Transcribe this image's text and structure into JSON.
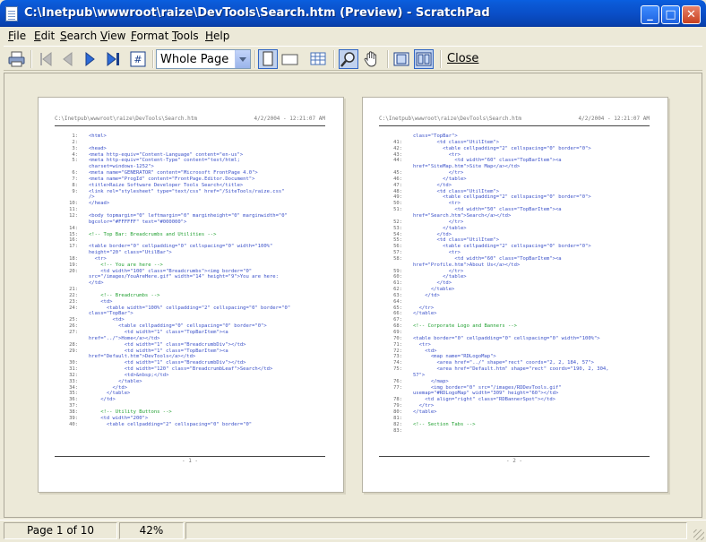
{
  "window": {
    "title": "C:\\Inetpub\\wwwroot\\raize\\DevTools\\Search.htm (Preview) - ScratchPad",
    "minimize": "_",
    "maximize": "□",
    "close": "✕"
  },
  "menu": [
    {
      "label": "File"
    },
    {
      "label": "Edit"
    },
    {
      "label": "Search"
    },
    {
      "label": "View"
    },
    {
      "label": "Format"
    },
    {
      "label": "Tools"
    },
    {
      "label": "Help"
    }
  ],
  "toolbar": {
    "zoom_value": "Whole Page",
    "close_label": "Close",
    "icons": [
      "printer-icon",
      "first-page-icon",
      "previous-page-icon",
      "next-page-icon",
      "last-page-icon",
      "goto-page-icon",
      "portrait-icon",
      "landscape-icon",
      "multi-page-icon",
      "zoom-icon",
      "hand-icon",
      "single-page-view-icon",
      "two-page-view-icon"
    ]
  },
  "pages": [
    {
      "header_path": "C:\\Inetpub\\wwwroot\\raize\\DevTools\\Search.htm",
      "header_date": "4/2/2004 - 12:21:07 AM",
      "footer": "- 1 -",
      "lines": [
        {
          "n": "1:",
          "t": "<html>",
          "k": "tag"
        },
        {
          "n": "2:",
          "t": "",
          "k": "tag"
        },
        {
          "n": "3:",
          "t": "<head>",
          "k": "tag"
        },
        {
          "n": "4:",
          "t": "<meta http-equiv=\"Content-Language\" content=\"en-us\">",
          "k": "tag"
        },
        {
          "n": "5:",
          "t": "<meta http-equiv=\"Content-Type\" content=\"text/html;",
          "k": "tag"
        },
        {
          "n": "",
          "t": "charset=windows-1252\">",
          "k": "tag"
        },
        {
          "n": "6:",
          "t": "<meta name=\"GENERATOR\" content=\"Microsoft FrontPage 4.0\">",
          "k": "tag"
        },
        {
          "n": "7:",
          "t": "<meta name=\"ProgId\" content=\"FrontPage.Editor.Document\">",
          "k": "tag"
        },
        {
          "n": "8:",
          "t": "<title>Raize Software Developer Tools Search</title>",
          "k": "tag"
        },
        {
          "n": "9:",
          "t": "<link rel=\"stylesheet\" type=\"text/css\" href=\"/SiteTools/raize.css\"",
          "k": "tag"
        },
        {
          "n": "",
          "t": "/>",
          "k": "tag"
        },
        {
          "n": "10:",
          "t": "</head>",
          "k": "tag"
        },
        {
          "n": "11:",
          "t": "",
          "k": "tag"
        },
        {
          "n": "12:",
          "t": "<body topmargin=\"0\" leftmargin=\"0\" marginheight=\"0\" marginwidth=\"0\"",
          "k": "tag"
        },
        {
          "n": "",
          "t": "bgcolor=\"#FFFFFF\" text=\"#000000\">",
          "k": "tag"
        },
        {
          "n": "14:",
          "t": "",
          "k": "tag"
        },
        {
          "n": "15:",
          "t": "<!-- Top Bar: Breadcrumbs and Utilities -->",
          "k": "cmt"
        },
        {
          "n": "16:",
          "t": "",
          "k": "tag"
        },
        {
          "n": "17:",
          "t": "<table border=\"0\" cellpadding=\"0\" cellspacing=\"0\" width=\"100%\"",
          "k": "tag"
        },
        {
          "n": "",
          "t": "height=\"20\" class=\"UtilBar\">",
          "k": "tag"
        },
        {
          "n": "18:",
          "t": "  <tr>",
          "k": "tag"
        },
        {
          "n": "19:",
          "t": "    <!-- You are here -->",
          "k": "cmt"
        },
        {
          "n": "20:",
          "t": "    <td width=\"100\" class=\"Breadcrumbs\"><img border=\"0\"",
          "k": "tag"
        },
        {
          "n": "",
          "t": "src=\"/images/YouAreHere.gif\" width=\"14\" height=\"9\">You are here:",
          "k": "tag"
        },
        {
          "n": "",
          "t": "</td>",
          "k": "tag"
        },
        {
          "n": "21:",
          "t": "",
          "k": "tag"
        },
        {
          "n": "22:",
          "t": "    <!-- Breadcrumbs -->",
          "k": "cmt"
        },
        {
          "n": "23:",
          "t": "    <td>",
          "k": "tag"
        },
        {
          "n": "24:",
          "t": "      <table width=\"100%\" cellpadding=\"2\" cellspacing=\"0\" border=\"0\"",
          "k": "tag"
        },
        {
          "n": "",
          "t": "class=\"TopBar\">",
          "k": "tag"
        },
        {
          "n": "25:",
          "t": "        <td>",
          "k": "tag"
        },
        {
          "n": "26:",
          "t": "          <table cellpadding=\"0\" cellspacing=\"0\" border=\"0\">",
          "k": "tag"
        },
        {
          "n": "27:",
          "t": "            <td width=\"1\" class=\"TopBarItem\"><a",
          "k": "tag"
        },
        {
          "n": "",
          "t": "href=\"../\">Home</a></td>",
          "k": "tag"
        },
        {
          "n": "28:",
          "t": "            <td width=\"1\" class=\"BreadcrumbDiv\"></td>",
          "k": "tag"
        },
        {
          "n": "29:",
          "t": "            <td width=\"1\" class=\"TopBarItem\"><a",
          "k": "tag"
        },
        {
          "n": "",
          "t": "href=\"Default.htm\">DevTools</a></td>",
          "k": "tag"
        },
        {
          "n": "30:",
          "t": "            <td width=\"1\" class=\"BreadcrumbDiv\"></td>",
          "k": "tag"
        },
        {
          "n": "31:",
          "t": "            <td width=\"120\" class=\"BreadcrumbLeaf\">Search</td>",
          "k": "tag"
        },
        {
          "n": "32:",
          "t": "            <td>&nbsp;</td>",
          "k": "tag"
        },
        {
          "n": "33:",
          "t": "          </table>",
          "k": "tag"
        },
        {
          "n": "34:",
          "t": "        </td>",
          "k": "tag"
        },
        {
          "n": "35:",
          "t": "      </table>",
          "k": "tag"
        },
        {
          "n": "36:",
          "t": "    </td>",
          "k": "tag"
        },
        {
          "n": "37:",
          "t": "",
          "k": "tag"
        },
        {
          "n": "38:",
          "t": "    <!-- Utility Buttons -->",
          "k": "cmt"
        },
        {
          "n": "39:",
          "t": "    <td width=\"200\">",
          "k": "tag"
        },
        {
          "n": "40:",
          "t": "      <table cellpadding=\"2\" cellspacing=\"0\" border=\"0\"",
          "k": "tag"
        }
      ]
    },
    {
      "header_path": "C:\\Inetpub\\wwwroot\\raize\\DevTools\\Search.htm",
      "header_date": "4/2/2004 - 12:21:07 AM",
      "footer": "- 2 -",
      "lines": [
        {
          "n": "",
          "t": "class=\"TopBar\">",
          "k": "tag"
        },
        {
          "n": "41:",
          "t": "        <td class=\"UtilItem\">",
          "k": "tag"
        },
        {
          "n": "42:",
          "t": "          <table cellpadding=\"2\" cellspacing=\"0\" border=\"0\">",
          "k": "tag"
        },
        {
          "n": "43:",
          "t": "            <tr>",
          "k": "tag"
        },
        {
          "n": "44:",
          "t": "              <td width=\"60\" class=\"TopBarItem\"><a",
          "k": "tag"
        },
        {
          "n": "",
          "t": "href=\"SiteMap.htm\">Site Map</a></td>",
          "k": "tag"
        },
        {
          "n": "45:",
          "t": "            </tr>",
          "k": "tag"
        },
        {
          "n": "46:",
          "t": "          </table>",
          "k": "tag"
        },
        {
          "n": "47:",
          "t": "        </td>",
          "k": "tag"
        },
        {
          "n": "48:",
          "t": "        <td class=\"UtilItem\">",
          "k": "tag"
        },
        {
          "n": "49:",
          "t": "          <table cellpadding=\"2\" cellspacing=\"0\" border=\"0\">",
          "k": "tag"
        },
        {
          "n": "50:",
          "t": "            <tr>",
          "k": "tag"
        },
        {
          "n": "51:",
          "t": "              <td width=\"50\" class=\"TopBarItem\"><a",
          "k": "tag"
        },
        {
          "n": "",
          "t": "href=\"Search.htm\">Search</a></td>",
          "k": "tag"
        },
        {
          "n": "52:",
          "t": "            </tr>",
          "k": "tag"
        },
        {
          "n": "53:",
          "t": "          </table>",
          "k": "tag"
        },
        {
          "n": "54:",
          "t": "        </td>",
          "k": "tag"
        },
        {
          "n": "55:",
          "t": "        <td class=\"UtilItem\">",
          "k": "tag"
        },
        {
          "n": "56:",
          "t": "          <table cellpadding=\"2\" cellspacing=\"0\" border=\"0\">",
          "k": "tag"
        },
        {
          "n": "57:",
          "t": "            <tr>",
          "k": "tag"
        },
        {
          "n": "58:",
          "t": "              <td width=\"60\" class=\"TopBarItem\"><a",
          "k": "tag"
        },
        {
          "n": "",
          "t": "href=\"Profile.htm\">About Us</a></td>",
          "k": "tag"
        },
        {
          "n": "59:",
          "t": "            </tr>",
          "k": "tag"
        },
        {
          "n": "60:",
          "t": "          </table>",
          "k": "tag"
        },
        {
          "n": "61:",
          "t": "        </td>",
          "k": "tag"
        },
        {
          "n": "62:",
          "t": "      </table>",
          "k": "tag"
        },
        {
          "n": "63:",
          "t": "    </td>",
          "k": "tag"
        },
        {
          "n": "64:",
          "t": "",
          "k": "tag"
        },
        {
          "n": "65:",
          "t": "  </tr>",
          "k": "tag"
        },
        {
          "n": "66:",
          "t": "</table>",
          "k": "tag"
        },
        {
          "n": "67:",
          "t": "",
          "k": "tag"
        },
        {
          "n": "68:",
          "t": "<!-- Corporate Logo and Banners -->",
          "k": "cmt"
        },
        {
          "n": "69:",
          "t": "",
          "k": "tag"
        },
        {
          "n": "70:",
          "t": "<table border=\"0\" cellpadding=\"0\" cellspacing=\"0\" width=\"100%\">",
          "k": "tag"
        },
        {
          "n": "71:",
          "t": "  <tr>",
          "k": "tag"
        },
        {
          "n": "72:",
          "t": "    <td>",
          "k": "tag"
        },
        {
          "n": "73:",
          "t": "      <map name=\"RDLogoMap\">",
          "k": "tag"
        },
        {
          "n": "74:",
          "t": "        <area href=\"../\" shape=\"rect\" coords=\"2, 2, 184, 57\">",
          "k": "tag"
        },
        {
          "n": "75:",
          "t": "        <area href=\"Default.htm\" shape=\"rect\" coords=\"190, 2, 304,",
          "k": "tag"
        },
        {
          "n": "",
          "t": "57\">",
          "k": "tag"
        },
        {
          "n": "76:",
          "t": "      </map>",
          "k": "tag"
        },
        {
          "n": "77:",
          "t": "      <img border=\"0\" src=\"/images/RDDevTools.gif\"",
          "k": "tag"
        },
        {
          "n": "",
          "t": "usemap=\"#RDLogoMap\" width=\"309\" height=\"60\"></td>",
          "k": "tag"
        },
        {
          "n": "78:",
          "t": "    <td align=\"right\" class=\"RDBannerSpot\"></td>",
          "k": "tag"
        },
        {
          "n": "79:",
          "t": "  </tr>",
          "k": "tag"
        },
        {
          "n": "80:",
          "t": "</table>",
          "k": "tag"
        },
        {
          "n": "81:",
          "t": "",
          "k": "tag"
        },
        {
          "n": "82:",
          "t": "<!-- Section Tabs -->",
          "k": "cmt"
        },
        {
          "n": "83:",
          "t": "",
          "k": "tag"
        }
      ]
    }
  ],
  "status": {
    "page_info": "Page 1 of 10",
    "zoom": "42%"
  }
}
